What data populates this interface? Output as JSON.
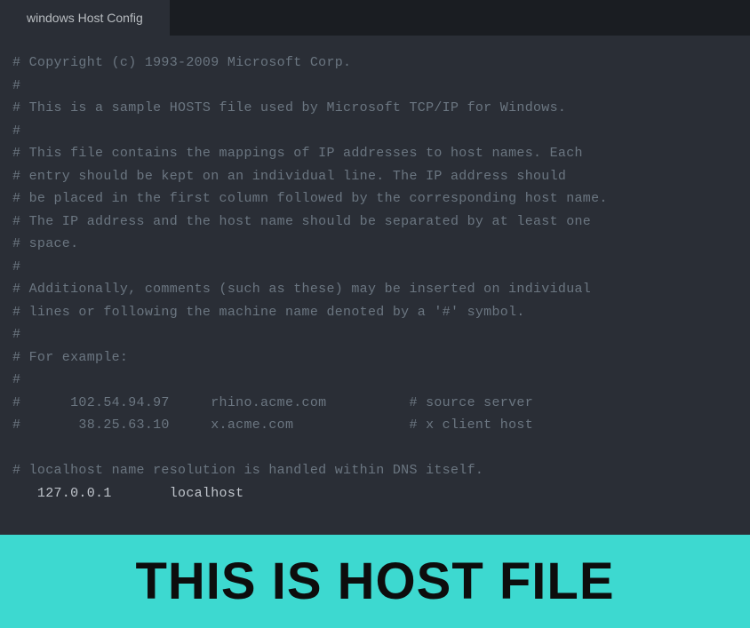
{
  "tab": {
    "label": "windows Host Config"
  },
  "lines": [
    {
      "type": "comment",
      "text": "# Copyright (c) 1993-2009 Microsoft Corp."
    },
    {
      "type": "comment",
      "text": "#"
    },
    {
      "type": "comment",
      "text": "# This is a sample HOSTS file used by Microsoft TCP/IP for Windows."
    },
    {
      "type": "comment",
      "text": "#"
    },
    {
      "type": "comment",
      "text": "# This file contains the mappings of IP addresses to host names. Each"
    },
    {
      "type": "comment",
      "text": "# entry should be kept on an individual line. The IP address should"
    },
    {
      "type": "comment",
      "text": "# be placed in the first column followed by the corresponding host name."
    },
    {
      "type": "comment",
      "text": "# The IP address and the host name should be separated by at least one"
    },
    {
      "type": "comment",
      "text": "# space."
    },
    {
      "type": "comment",
      "text": "#"
    },
    {
      "type": "comment",
      "text": "# Additionally, comments (such as these) may be inserted on individual"
    },
    {
      "type": "comment",
      "text": "# lines or following the machine name denoted by a '#' symbol."
    },
    {
      "type": "comment",
      "text": "#"
    },
    {
      "type": "comment",
      "text": "# For example:"
    },
    {
      "type": "comment",
      "text": "#"
    },
    {
      "type": "comment",
      "text": "#      102.54.94.97     rhino.acme.com          # source server"
    },
    {
      "type": "comment",
      "text": "#       38.25.63.10     x.acme.com              # x client host"
    },
    {
      "type": "blank",
      "text": " "
    },
    {
      "type": "comment",
      "text": "# localhost name resolution is handled within DNS itself."
    },
    {
      "type": "code",
      "text": "   127.0.0.1       localhost"
    }
  ],
  "banner": {
    "text": "THIS IS HOST FILE"
  }
}
